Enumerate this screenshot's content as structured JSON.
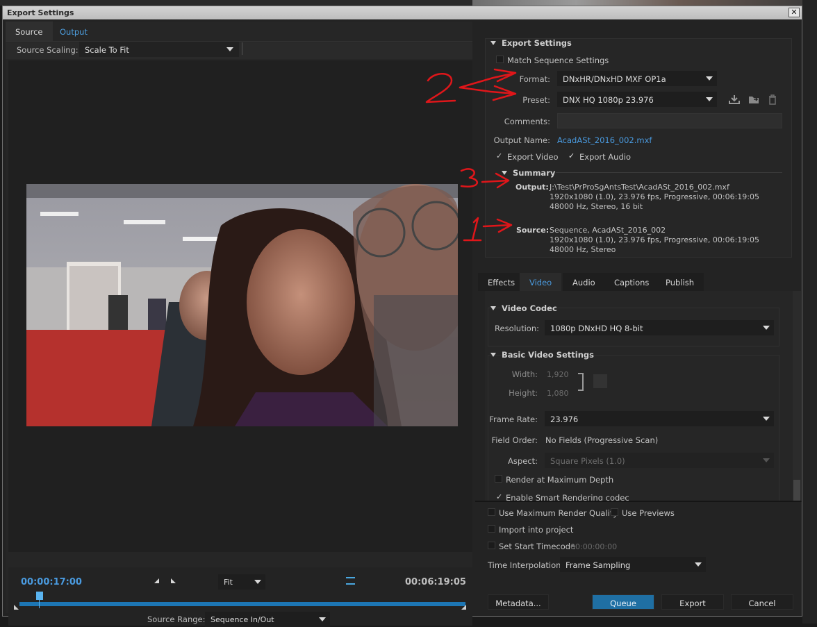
{
  "window": {
    "title": "Export Settings",
    "close": "✕"
  },
  "left": {
    "tabs": [
      "Source",
      "Output"
    ],
    "source_scaling_label": "Source Scaling:",
    "source_scaling_value": "Scale To Fit",
    "timecode_current": "00:00:17:00",
    "timecode_end": "00:06:19:05",
    "fit_value": "Fit",
    "source_range_label": "Source Range:",
    "source_range_value": "Sequence In/Out"
  },
  "export_settings": {
    "heading": "Export Settings",
    "match_sequence": "Match Sequence Settings",
    "format_label": "Format:",
    "format_value": "DNxHR/DNxHD MXF OP1a",
    "preset_label": "Preset:",
    "preset_value": "DNX HQ 1080p 23.976",
    "comments_label": "Comments:",
    "output_name_label": "Output Name:",
    "output_name_value": "AcadASt_2016_002.mxf",
    "export_video": "Export Video",
    "export_audio": "Export Audio",
    "summary_heading": "Summary",
    "summary_output_label": "Output:",
    "summary_output_lines": [
      "J:\\Test\\PrProSgAntsTest\\AcadASt_2016_002.mxf",
      "1920x1080 (1.0), 23.976 fps, Progressive, 00:06:19:05",
      "48000 Hz, Stereo, 16 bit"
    ],
    "summary_source_label": "Source:",
    "summary_source_lines": [
      "Sequence, AcadASt_2016_002",
      "1920x1080 (1.0), 23.976 fps, Progressive, 00:06:19:05",
      "48000 Hz, Stereo"
    ]
  },
  "tabs2": [
    "Effects",
    "Video",
    "Audio",
    "Captions",
    "Publish"
  ],
  "video": {
    "codec_heading": "Video Codec",
    "resolution_label": "Resolution:",
    "resolution_value": "1080p DNxHD HQ 8-bit",
    "basic_heading": "Basic Video Settings",
    "width_label": "Width:",
    "width_value": "1,920",
    "height_label": "Height:",
    "height_value": "1,080",
    "frame_rate_label": "Frame Rate:",
    "frame_rate_value": "23.976",
    "field_order_label": "Field Order:",
    "field_order_value": "No Fields (Progressive Scan)",
    "aspect_label": "Aspect:",
    "aspect_value": "Square Pixels (1.0)",
    "render_max_depth": "Render at Maximum Depth",
    "smart_rendering": "Enable Smart Rendering codec"
  },
  "bottom": {
    "use_max_render": "Use Maximum Render Quality",
    "use_previews": "Use Previews",
    "import_project": "Import into project",
    "set_start_tc": "Set Start Timecode",
    "start_tc_value": "00:00:00:00",
    "time_interp_label": "Time Interpolation:",
    "time_interp_value": "Frame Sampling",
    "metadata_btn": "Metadata...",
    "queue_btn": "Queue",
    "export_btn": "Export",
    "cancel_btn": "Cancel"
  },
  "colors": {
    "accent": "#4a9be0",
    "queue_button": "#1f6fa3",
    "annotation_red": "#e0161a"
  }
}
